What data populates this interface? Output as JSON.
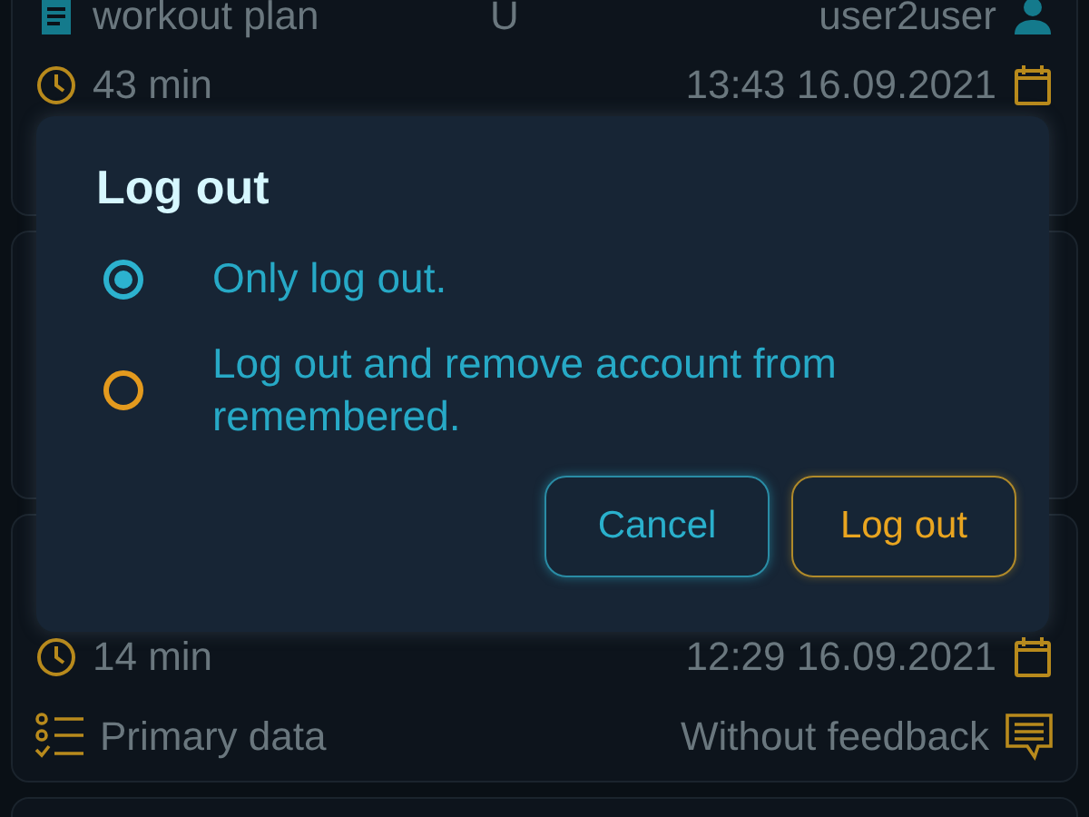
{
  "cards": [
    {
      "rows": [
        {
          "kind": "plan",
          "left": "workout plan",
          "middle": "U",
          "right": "user2user"
        },
        {
          "kind": "time",
          "left": "43 min",
          "right": "13:43 16.09.2021"
        }
      ]
    },
    {
      "rows": [
        {
          "kind": "time",
          "left": "14 min",
          "right": "12:29 16.09.2021"
        },
        {
          "kind": "status",
          "left": "Primary data",
          "right": "Without feedback"
        }
      ]
    }
  ],
  "dialog": {
    "title": "Log out",
    "options": [
      {
        "label": "Only log out.",
        "selected": true
      },
      {
        "label": "Log out and remove account from remembered.",
        "selected": false
      }
    ],
    "buttons": [
      {
        "label": "Cancel",
        "kind": "secondary"
      },
      {
        "label": "Log out",
        "kind": "primary"
      }
    ]
  }
}
